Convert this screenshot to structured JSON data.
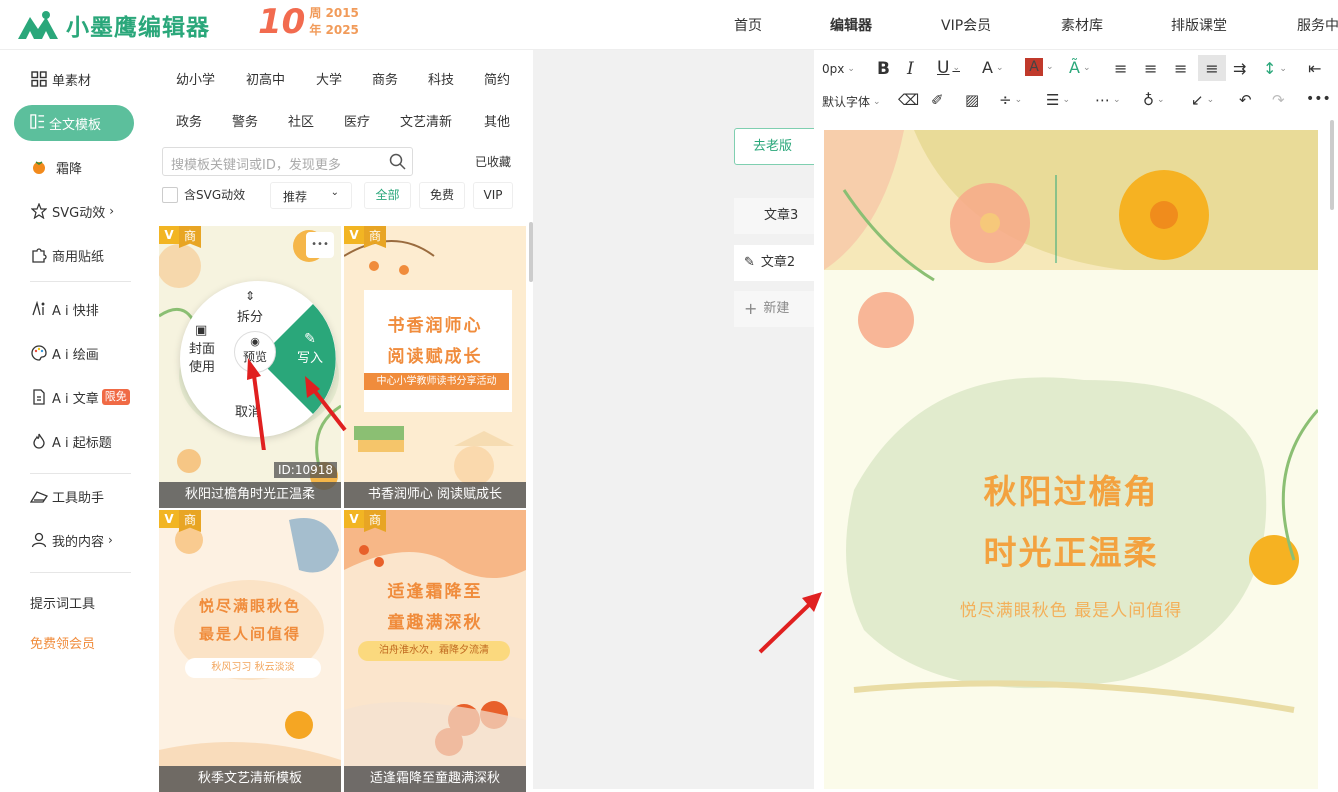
{
  "header": {
    "logo_text": "小墨鹰编辑器",
    "anniv_num": "10",
    "anniv_line1": "周 2015",
    "anniv_line2": "年 2025",
    "nav": [
      "首页",
      "编辑器",
      "VIP会员",
      "素材库",
      "排版课堂",
      "服务中"
    ]
  },
  "sidebar": {
    "items": [
      {
        "label": "单素材",
        "icon": "grid-icon"
      },
      {
        "label": "全文模板",
        "icon": "template-icon"
      },
      {
        "label": "霜降",
        "icon": "persimmon-icon"
      },
      {
        "label": "SVG动效",
        "icon": "star-icon"
      },
      {
        "label": "商用贴纸",
        "icon": "puzzle-icon"
      },
      {
        "label": "A i 快排",
        "icon": "ai-layout-icon"
      },
      {
        "label": "A i 绘画",
        "icon": "palette-icon"
      },
      {
        "label": "A i 文章",
        "icon": "document-icon"
      },
      {
        "label": "A i 起标题",
        "icon": "flame-icon"
      },
      {
        "label": "工具助手",
        "icon": "tools-icon"
      },
      {
        "label": "我的内容",
        "icon": "user-icon"
      }
    ],
    "ai_article_badge": "限免",
    "prompt_tools": "提示词工具",
    "free_vip": "免费领会员"
  },
  "templates": {
    "categories_row1": [
      "幼小学",
      "初高中",
      "大学",
      "商务",
      "科技",
      "简约"
    ],
    "categories_row2": [
      "政务",
      "警务",
      "社区",
      "医疗",
      "文艺清新",
      "其他"
    ],
    "search_placeholder": "搜模板关键词或ID，发现更多",
    "favorites": "已收藏",
    "svg_checkbox": "含SVG动效",
    "sort_select": "推荐",
    "filters": [
      "全部",
      "免费",
      "VIP"
    ],
    "active_filter": "全部",
    "vip_tag": "V",
    "biz_tag": "商",
    "cards": [
      {
        "caption": "秋阳过檐角时光正温柔",
        "id_label": "ID:10918",
        "texts": []
      },
      {
        "caption": "书香润师心 阅读赋成长",
        "texts": [
          "书香润师心",
          "阅读赋成长",
          "中心小学教师读书分享活动"
        ]
      },
      {
        "caption": "秋季文艺清新模板",
        "texts": [
          "悦尽满眼秋色",
          "最是人间值得",
          "秋风习习 秋云淡淡"
        ]
      },
      {
        "caption": "适逢霜降至童趣满深秋",
        "texts": [
          "适逢霜降至",
          "童趣满深秋",
          "泊舟淮水次，霜降夕流清"
        ]
      }
    ],
    "radial_menu": {
      "split": "拆分",
      "cover_line1": "封面",
      "cover_line2": "使用",
      "preview": "预览",
      "write": "写入",
      "cancel": "取消",
      "more": "•••"
    }
  },
  "middle": {
    "old_version_button": "去老版",
    "docs": [
      {
        "label": "文章3"
      },
      {
        "label": "文章2"
      }
    ],
    "new_doc": "新建"
  },
  "editor": {
    "font_size": "0px",
    "font_family": "默认字体",
    "canvas_title_line1": "秋阳过檐角",
    "canvas_title_line2": "时光正温柔",
    "canvas_subtitle": "悦尽满眼秋色 最是人间值得",
    "font_color": "#c0392b",
    "accent": "#2aa77a"
  }
}
